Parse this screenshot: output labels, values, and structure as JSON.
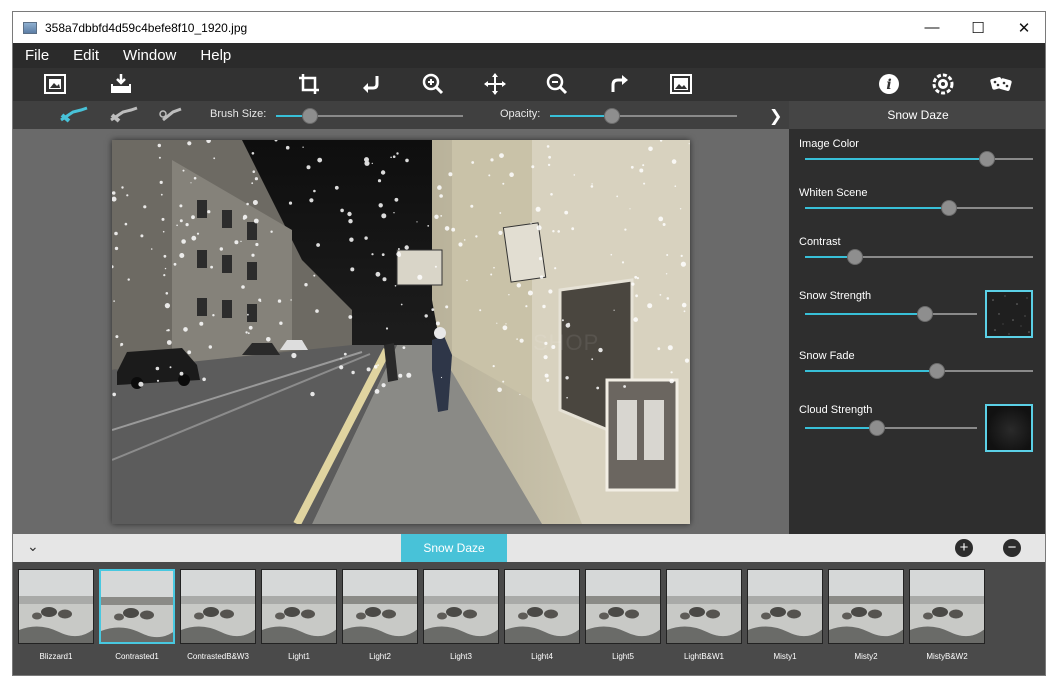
{
  "window": {
    "title": "358a7dbbfd4d59c4befe8f10_1920.jpg",
    "controls": {
      "minimize": "—",
      "maximize": "☐",
      "close": "✕"
    }
  },
  "menu": [
    "File",
    "Edit",
    "Window",
    "Help"
  ],
  "toolbar": {
    "icons": [
      "open-image-icon",
      "save-icon",
      "crop-icon",
      "undo-icon",
      "zoom-in-icon",
      "move-icon",
      "zoom-out-icon",
      "redo-icon",
      "fit-image-icon",
      "info-icon",
      "settings-icon",
      "dice-icon"
    ]
  },
  "brushbar": {
    "brush_size_label": "Brush Size:",
    "brush_size": 0.18,
    "opacity_label": "Opacity:",
    "opacity": 0.33
  },
  "panel": {
    "title": "Snow Daze",
    "params": [
      {
        "label": "Image Color",
        "value": 0.8
      },
      {
        "label": "Whiten Scene",
        "value": 0.63
      },
      {
        "label": "Contrast",
        "value": 0.22
      },
      {
        "label": "Snow Strength",
        "value": 0.7
      },
      {
        "label": "Snow Fade",
        "value": 0.58
      },
      {
        "label": "Cloud Strength",
        "value": 0.42
      }
    ]
  },
  "canvas": {
    "watermark": "SHOP"
  },
  "presets": {
    "active_tab": "Snow Daze",
    "add": "+",
    "remove": "−",
    "items": [
      "Blizzard1",
      "Contrasted1",
      "ContrastedB&W3",
      "Light1",
      "Light2",
      "Light3",
      "Light4",
      "Light5",
      "LightB&W1",
      "Misty1",
      "Misty2",
      "MistyB&W2"
    ],
    "selected": "Contrasted1"
  },
  "colors": {
    "accent": "#48c2d8",
    "dark_bg": "#2f2f2f",
    "panel_bg": "#2e2e2e"
  }
}
